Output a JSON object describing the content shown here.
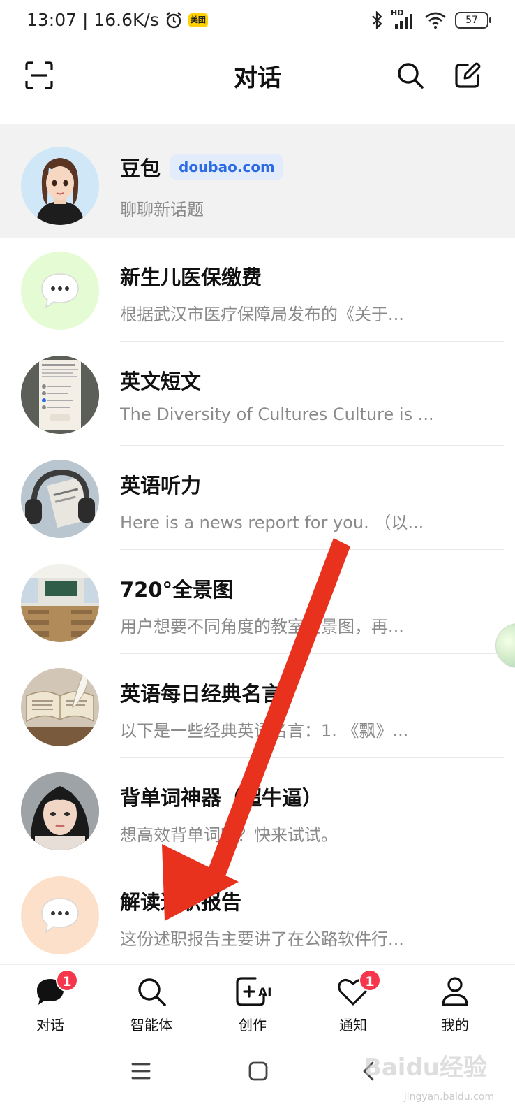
{
  "status_bar": {
    "time_speed": "13:07 | 16.6K/s",
    "meituan_badge": "美团",
    "network_label": "HD",
    "battery": "57"
  },
  "header": {
    "title": "对话",
    "scan_icon": "scan-icon",
    "search_icon": "search-icon",
    "compose_icon": "compose-icon"
  },
  "chats": [
    {
      "title": "豆包",
      "badge": "doubao.com",
      "preview": "聊聊新话题"
    },
    {
      "title": "新生儿医保缴费",
      "preview": "根据武汉市医疗保障局发布的《关于..."
    },
    {
      "title": "英文短文",
      "preview": "The Diversity of Cultures Culture is ..."
    },
    {
      "title": "英语听力",
      "preview": "Here is a news report for you. （以..."
    },
    {
      "title": "720°全景图",
      "preview": "用户想要不同角度的教室全景图，再..."
    },
    {
      "title": "英语每日经典名言",
      "preview": "以下是一些经典英语名言：1. 《飘》..."
    },
    {
      "title": "背单词神器（超牛逼）",
      "preview": "想高效背单词吗？快来试试。"
    },
    {
      "title": "解读述职报告",
      "preview": "这份述职报告主要讲了在公路软件行..."
    }
  ],
  "tabs": [
    {
      "label": "对话",
      "badge": "1"
    },
    {
      "label": "智能体"
    },
    {
      "label": "创作",
      "icon_text": "AI"
    },
    {
      "label": "通知",
      "badge": "1"
    },
    {
      "label": "我的"
    }
  ],
  "watermark": {
    "text": "Baidu经验",
    "sub": "jingyan.baidu.com"
  },
  "colors": {
    "accent_blue": "#2d6be4",
    "badge_red": "#f5364b",
    "arrow_red": "#e8321e"
  }
}
